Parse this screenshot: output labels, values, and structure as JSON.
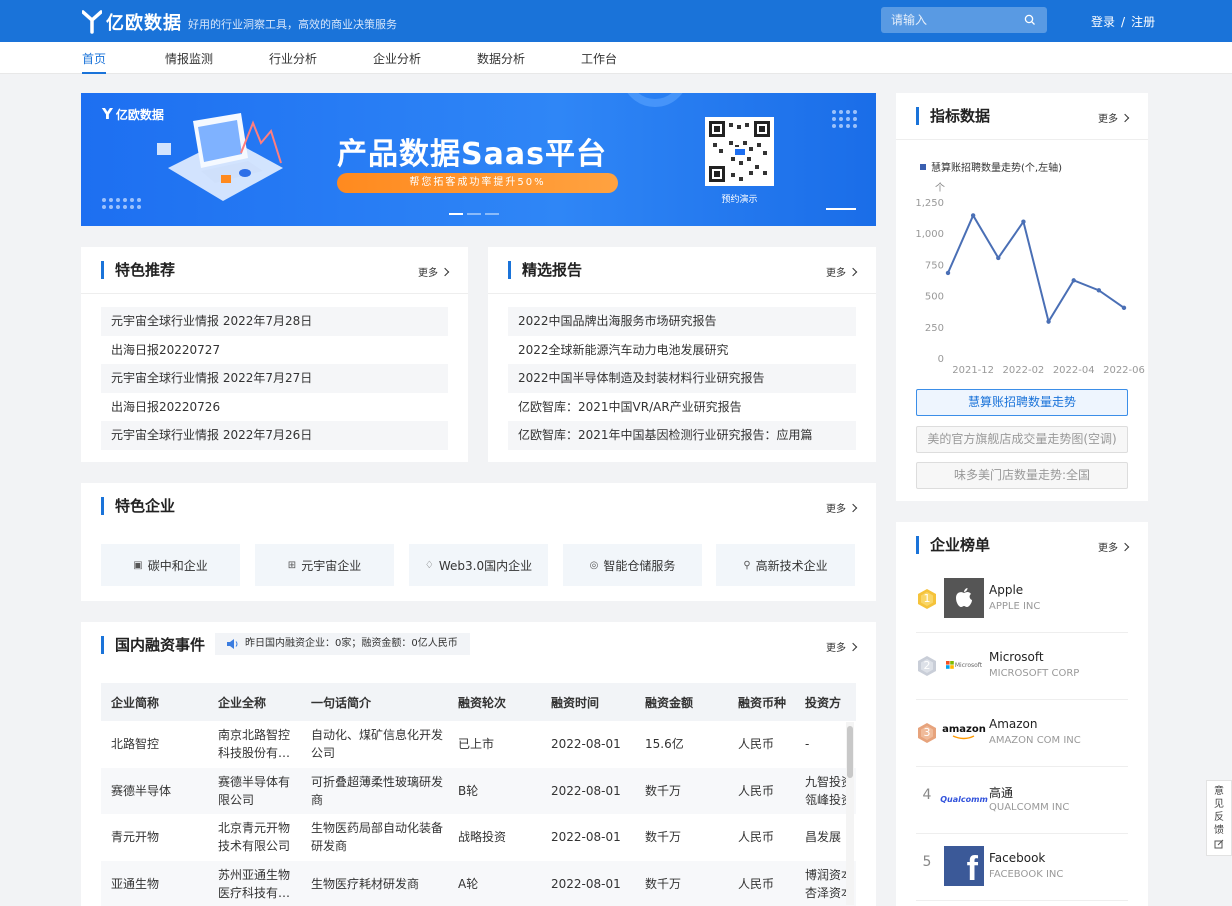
{
  "header": {
    "logo_text": "亿欧数据",
    "slogan": "好用的行业洞察工具，高效的商业决策服务",
    "search_placeholder": "请输入",
    "login": "登录",
    "separator": "/",
    "register": "注册"
  },
  "nav": {
    "items": [
      "首页",
      "情报监测",
      "行业分析",
      "企业分析",
      "数据分析",
      "工作台"
    ],
    "active": "首页"
  },
  "banner": {
    "logo_text": "亿欧数据",
    "title": "产品数据Saas平台",
    "pill": "帮您拓客成功率提升50%",
    "qr_label": "预约演示"
  },
  "featured": {
    "title": "特色推荐",
    "more": "更多",
    "items": [
      "元宇宙全球行业情报 2022年7月28日",
      "出海日报20220727",
      "元宇宙全球行业情报 2022年7月27日",
      "出海日报20220726",
      "元宇宙全球行业情报 2022年7月26日"
    ]
  },
  "reports": {
    "title": "精选报告",
    "more": "更多",
    "items": [
      "2022中国品牌出海服务市场研究报告",
      "2022全球新能源汽车动力电池发展研究",
      "2022中国半导体制造及封装材料行业研究报告",
      "亿欧智库：2021中国VR/AR产业研究报告",
      "亿欧智库：2021年中国基因检测行业研究报告：应用篇"
    ]
  },
  "enterprises": {
    "title": "特色企业",
    "more": "更多",
    "items": [
      {
        "label": "碳中和企业",
        "icon": "document-icon"
      },
      {
        "label": "元宇宙企业",
        "icon": "grid-icon"
      },
      {
        "label": "Web3.0国内企业",
        "icon": "diamond-icon"
      },
      {
        "label": "智能仓储服务",
        "icon": "target-icon"
      },
      {
        "label": "高新技术企业",
        "icon": "trophy-icon"
      }
    ]
  },
  "financing": {
    "title": "国内融资事件",
    "notice": "昨日国内融资企业：0家；融资金额：0亿人民币",
    "more": "更多",
    "columns": [
      "企业简称",
      "企业全称",
      "一句话简介",
      "融资轮次",
      "融资时间",
      "融资金额",
      "融资币种",
      "投资方"
    ],
    "rows": [
      [
        "北路智控",
        "南京北路智控科技股份有…",
        "自动化、煤矿信息化开发公司",
        "已上市",
        "2022-08-01",
        "15.6亿",
        "人民币",
        "-"
      ],
      [
        "赛德半导体",
        "赛德半导体有限公司",
        "可折叠超薄柔性玻璃研发商",
        "B轮",
        "2022-08-01",
        "数千万",
        "人民币",
        "九智投资 瓴峰投资"
      ],
      [
        "青元开物",
        "北京青元开物技术有限公司",
        "生物医药局部自动化装备研发商",
        "战略投资",
        "2022-08-01",
        "数千万",
        "人民币",
        "昌发展"
      ],
      [
        "亚通生物",
        "苏州亚通生物医疗科技有…",
        "生物医疗耗材研发商",
        "A轮",
        "2022-08-01",
        "数千万",
        "人民币",
        "博润资本 杏泽资本"
      ]
    ]
  },
  "indicators": {
    "title": "指标数据",
    "more": "更多",
    "buttons": [
      "慧算账招聘数量走势",
      "美的官方旗舰店成交量走势图(空调)",
      "味多美门店数量走势:全国"
    ],
    "active_button": "慧算账招聘数量走势"
  },
  "chart_data": {
    "type": "line",
    "series": [
      {
        "name": "慧算账招聘数量走势(个,左轴)",
        "values": [
          690,
          1150,
          810,
          1100,
          300,
          630,
          550,
          410
        ],
        "color": "#4a6fb5"
      }
    ],
    "x": [
      "2021-11",
      "2021-12",
      "2022-01",
      "2022-02",
      "2022-03",
      "2022-04",
      "2022-05",
      "2022-06"
    ],
    "x_tick_labels": [
      "2021-12",
      "2022-02",
      "2022-04",
      "2022-06"
    ],
    "ylabel": "个",
    "y_ticks": [
      "0",
      "250",
      "500",
      "750",
      "1,000",
      "1,250"
    ],
    "ylim": [
      0,
      1250
    ],
    "grid": false
  },
  "rankings": {
    "title": "企业榜单",
    "more": "更多",
    "items": [
      {
        "rank": "1",
        "name": "Apple",
        "sub": "APPLE INC",
        "logo": "apple-logo"
      },
      {
        "rank": "2",
        "name": "Microsoft",
        "sub": "MICROSOFT CORP",
        "logo": "microsoft-logo",
        "logo_text": "Microsoft"
      },
      {
        "rank": "3",
        "name": "Amazon",
        "sub": "AMAZON COM INC",
        "logo": "amazon-logo",
        "logo_text": "amazon"
      },
      {
        "rank": "4",
        "name": "高通",
        "sub": "QUALCOMM INC",
        "logo": "qualcomm-logo",
        "logo_text": "Qualcomm"
      },
      {
        "rank": "5",
        "name": "Facebook",
        "sub": "FACEBOOK INC",
        "logo": "facebook-logo",
        "logo_text": "f"
      }
    ]
  },
  "feedback": {
    "label": "意见反馈"
  }
}
